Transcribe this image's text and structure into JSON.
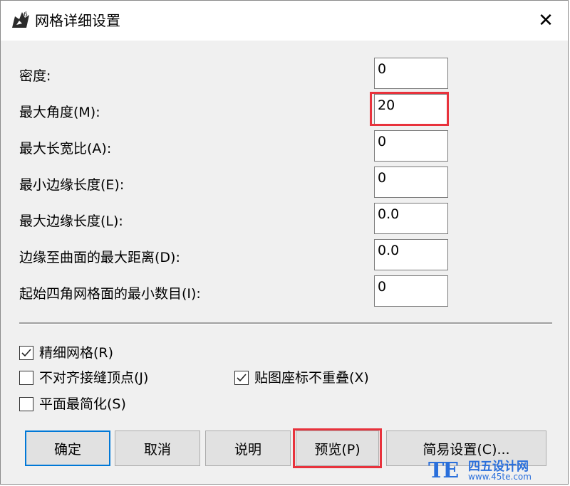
{
  "window": {
    "title": "网格详细设置",
    "close_label": "✕"
  },
  "fields": [
    {
      "label": "密度:",
      "value": "0"
    },
    {
      "label": "最大角度(M):",
      "value": "20"
    },
    {
      "label": "最大长宽比(A):",
      "value": "0"
    },
    {
      "label": "最小边缘长度(E):",
      "value": "0"
    },
    {
      "label": "最大边缘长度(L):",
      "value": "0.0"
    },
    {
      "label": "边缘至曲面的最大距离(D):",
      "value": "0.0"
    },
    {
      "label": "起始四角网格面的最小数目(I):",
      "value": "0"
    }
  ],
  "checkboxes": {
    "refine_mesh": {
      "label": "精细网格(R)",
      "checked": true
    },
    "jagged_seams": {
      "label": "不对齐接缝顶点(J)",
      "checked": false
    },
    "texture_overlap": {
      "label": "贴图座标不重叠(X)",
      "checked": true
    },
    "simple_planes": {
      "label": "平面最简化(S)",
      "checked": false
    }
  },
  "buttons": {
    "ok": "确定",
    "cancel": "取消",
    "help": "说明",
    "preview": "预览(P)",
    "simple_settings": "简易设置(C)..."
  },
  "watermark": {
    "logo": "TE",
    "name": "四五设计网",
    "url": "www.45te.com"
  },
  "colors": {
    "highlight": "#e8323c",
    "default_button_border": "#0078d7",
    "watermark": "#2a6fdb"
  }
}
